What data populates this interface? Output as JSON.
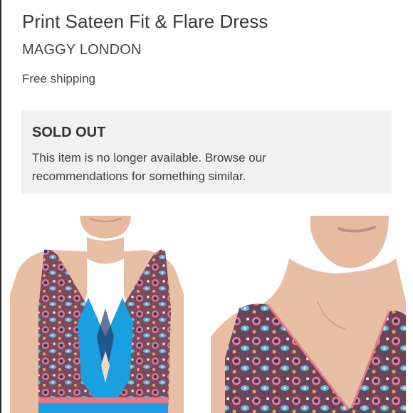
{
  "product": {
    "title": "Print Sateen Fit & Flare Dress",
    "brand": "MAGGY LONDON",
    "shipping": "Free shipping"
  },
  "availability": {
    "status": "SOLD OUT",
    "message": "This item is no longer available. Browse our recommendations for something similar."
  },
  "colors": {
    "skin": "#e8bfa4",
    "dress_blue": "#1a9fe0",
    "dress_navy": "#243a6a",
    "dress_pink": "#e8788a",
    "panel_bg": "#f1f1f1"
  },
  "gallery": {
    "images": [
      {
        "name": "front-view"
      },
      {
        "name": "closeup-neckline"
      }
    ]
  }
}
